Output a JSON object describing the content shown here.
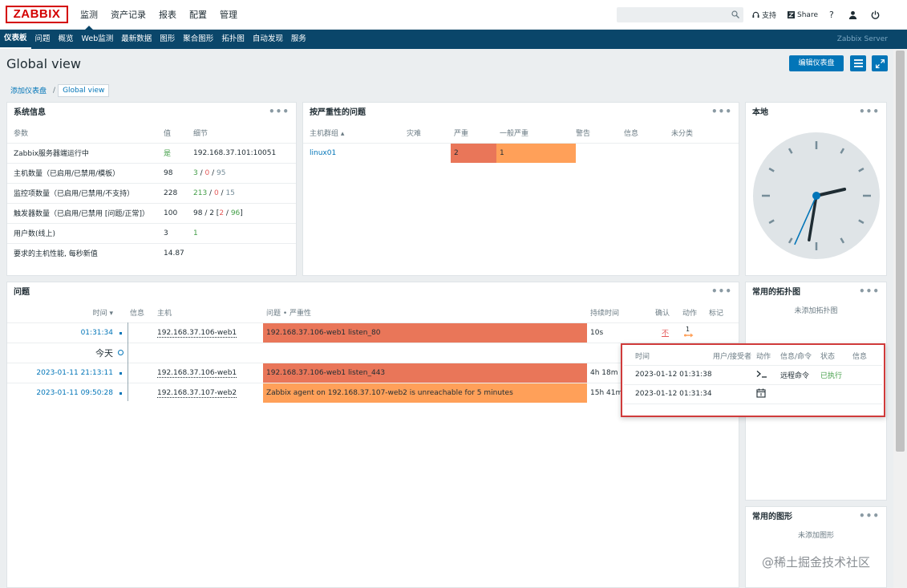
{
  "brand": "ZABBIX",
  "main_nav": [
    "监测",
    "资产记录",
    "报表",
    "配置",
    "管理"
  ],
  "top_links": {
    "support": "支持",
    "share": "Share",
    "help": "?"
  },
  "sub_nav": [
    "仪表板",
    "问题",
    "概览",
    "Web监测",
    "最新数据",
    "图形",
    "聚合图形",
    "拓扑图",
    "自动发现",
    "服务"
  ],
  "server_name": "Zabbix Server",
  "page_title": "Global view",
  "edit_dashboard": "编辑仪表盘",
  "breadcrumb": [
    "添加仪表盘",
    "Global view"
  ],
  "sysinfo": {
    "title": "系统信息",
    "headers": [
      "参数",
      "值",
      "细节"
    ],
    "rows": [
      {
        "param": "Zabbix服务器端运行中",
        "value": "是",
        "detail": "192.168.37.101:10051"
      },
      {
        "param": "主机数量（已启用/已禁用/模板）",
        "value": "98",
        "d1": "3",
        "d2": "0",
        "d3": "95"
      },
      {
        "param": "监控项数量（已启用/已禁用/不支持）",
        "value": "228",
        "d1": "213",
        "d2": "0",
        "d3": "15"
      },
      {
        "param": "触发器数量（已启用/已禁用 [问题/正常]）",
        "value": "100",
        "d1": "98 / 2 [",
        "d2": "2",
        "d3": "96",
        "d4": "]"
      },
      {
        "param": "用户数(线上)",
        "value": "3",
        "d1": "1"
      },
      {
        "param": "要求的主机性能, 每秒新值",
        "value": "14.87"
      }
    ]
  },
  "severity": {
    "title": "按严重性的问题",
    "headers": [
      "主机群组 ▴",
      "灾难",
      "严重",
      "一般严重",
      "警告",
      "信息",
      "未分类"
    ],
    "row": {
      "group": "linux01",
      "high": "2",
      "average": "1"
    }
  },
  "clock": {
    "title": "本地",
    "hour": 1,
    "minute": 31,
    "second": 34
  },
  "problems": {
    "title": "问题",
    "headers": [
      "时间 ▾",
      "信息",
      "主机",
      "问题 • 严重性",
      "持续时间",
      "确认",
      "动作",
      "标记"
    ],
    "rows": [
      {
        "time": "01:31:34",
        "host": "192.168.37.106-web1",
        "problem": "192.168.37.106-web1 listen_80",
        "duration": "10s",
        "ack": "不",
        "actions": "1"
      },
      {
        "divider": "今天"
      },
      {
        "time": "2023-01-11 21:13:11",
        "host": "192.168.37.106-web1",
        "problem": "192.168.37.106-web1 listen_443",
        "duration": "4h 18m"
      },
      {
        "time": "2023-01-11 09:50:28",
        "host": "192.168.37.107-web2",
        "problem": "Zabbix agent on 192.168.37.107-web2 is unreachable for 5 minutes",
        "duration": "15h 41m"
      }
    ]
  },
  "popup": {
    "headers": [
      "时间",
      "用户/接受者",
      "动作",
      "信息/命令",
      "状态",
      "信息"
    ],
    "rows": [
      {
        "time": "2023-01-12 01:31:38",
        "cmd": "远程命令",
        "status": "已执行"
      },
      {
        "time": "2023-01-12 01:31:34"
      }
    ]
  },
  "maps": {
    "title": "常用的拓扑图",
    "empty": "未添加拓扑图"
  },
  "graphs": {
    "title": "常用的图形",
    "empty": "未添加图形"
  },
  "watermark": "@稀土掘金技术社区"
}
